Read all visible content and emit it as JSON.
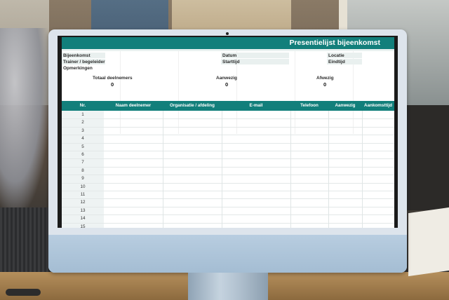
{
  "sheet": {
    "title": "Presentielijst bijeenkomst",
    "info_labels": {
      "bijeenkomst": "Bijeenkomst",
      "trainer": "Trainer / begeleider",
      "opmerkingen": "Opmerkingen",
      "datum": "Datum",
      "starttijd": "Starttijd",
      "locatie": "Locatie",
      "eindtijd": "Eindtijd"
    },
    "summary": [
      {
        "label": "Totaal deelnemers",
        "value": "0"
      },
      {
        "label": "Aanwezig",
        "value": "0"
      },
      {
        "label": "Afwezig",
        "value": "0"
      }
    ],
    "columns": [
      "Nr.",
      "Naam deelnemer",
      "Organisatie / afdeling",
      "E-mail",
      "Telefoon",
      "Aanwezig",
      "Aankomsttijd"
    ],
    "rows": [
      "1",
      "2",
      "3",
      "4",
      "5",
      "6",
      "7",
      "8",
      "9",
      "10",
      "11",
      "12",
      "13",
      "14",
      "15"
    ]
  },
  "colors": {
    "teal": "#127f7b",
    "light_teal": "#e9f0ef"
  }
}
